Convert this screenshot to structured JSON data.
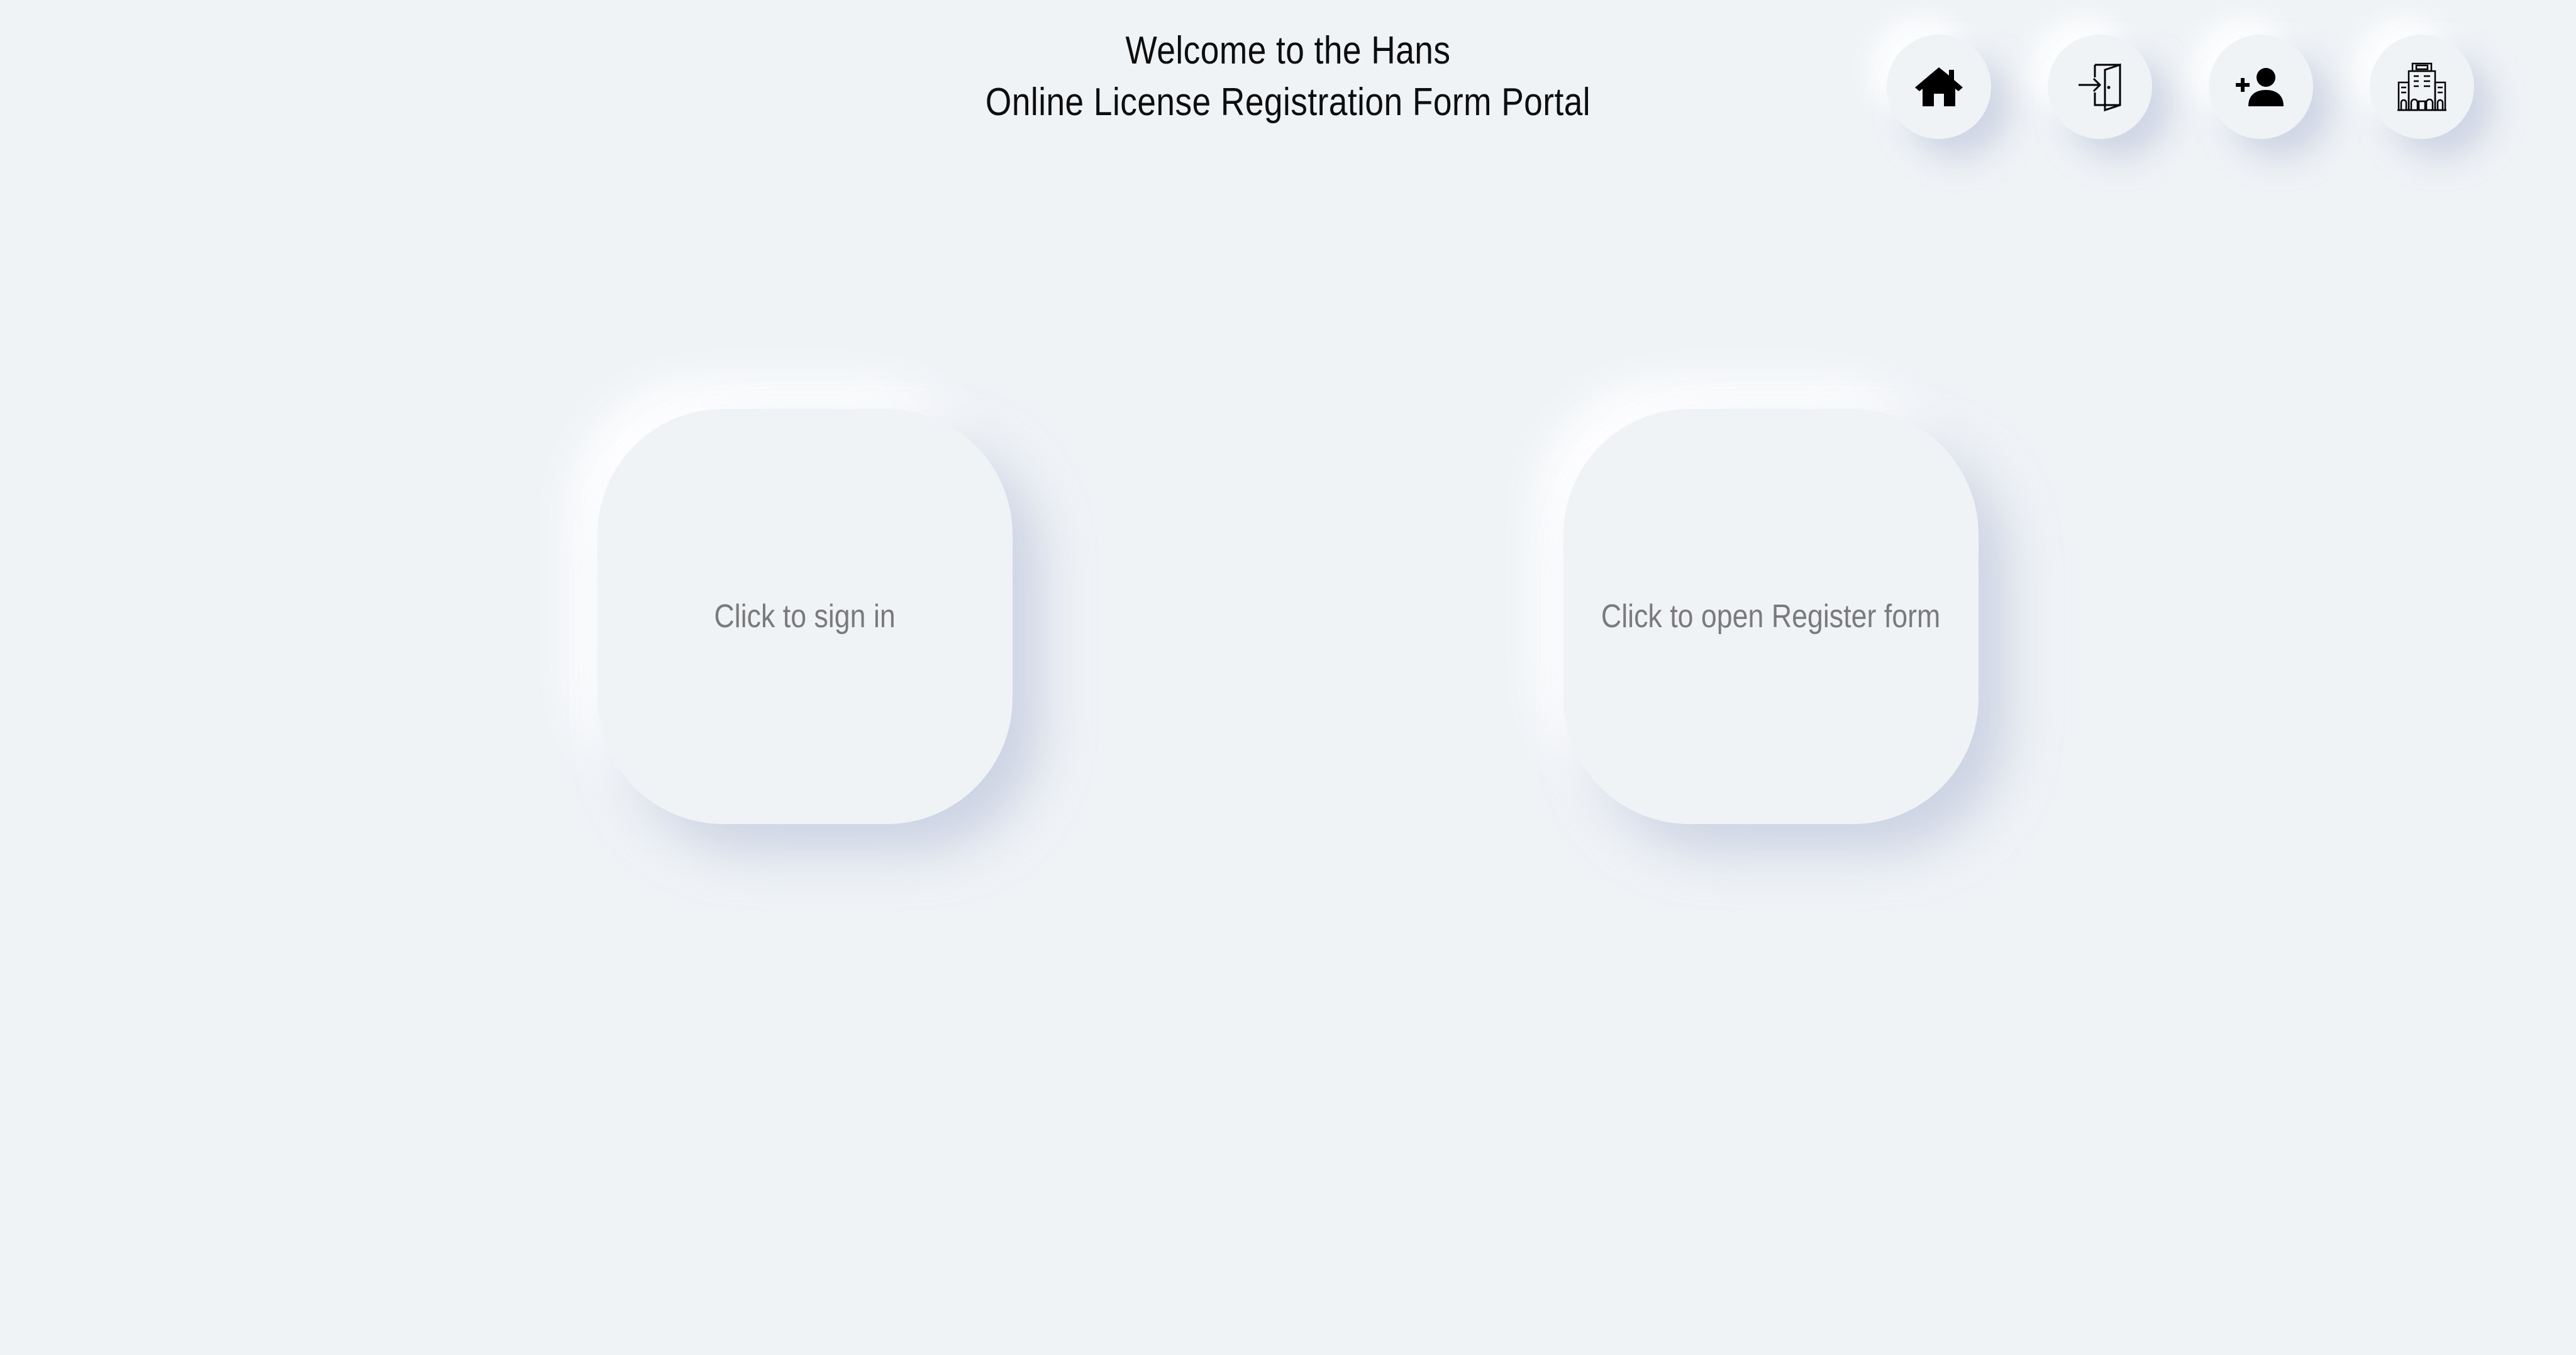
{
  "header": {
    "title_line1": "Welcome to the Hans",
    "title_line2": "Online License Registration Form Portal"
  },
  "nav": {
    "buttons": [
      {
        "icon": "home-icon"
      },
      {
        "icon": "sign-in-door-icon"
      },
      {
        "icon": "add-user-icon"
      },
      {
        "icon": "building-icon"
      }
    ]
  },
  "cards": {
    "signin_label": "Click to sign in",
    "register_label": "Click to open Register form"
  },
  "colors": {
    "background": "#eff3f6",
    "title_text": "#0d0d0d",
    "card_text": "#7a7a7a",
    "icon": "#000000"
  }
}
